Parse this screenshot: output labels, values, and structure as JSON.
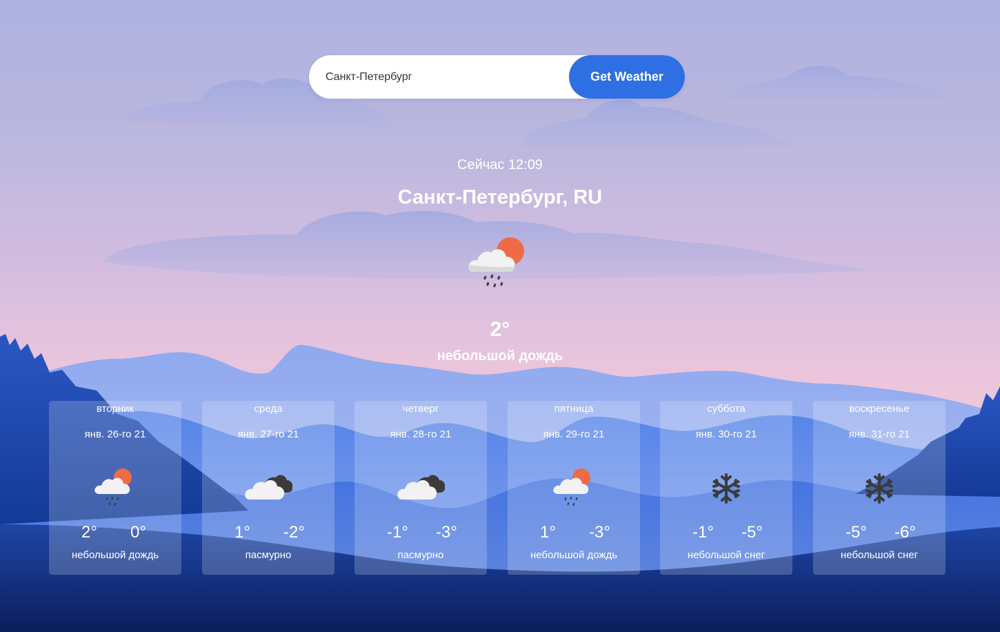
{
  "search": {
    "value": "Санкт-Петербург",
    "button_label": "Get Weather"
  },
  "current": {
    "time_label": "Сейчас 12:09",
    "location": "Санкт-Петербург, RU",
    "icon": "light-rain-sun-icon",
    "temperature": "2°",
    "description": "небольшой дождь"
  },
  "forecast": [
    {
      "day": "вторник",
      "date": "янв. 26-го 21",
      "icon": "light-rain-sun-icon",
      "max": "2°",
      "min": "0°",
      "description": "небольшой дождь"
    },
    {
      "day": "среда",
      "date": "янв. 27-го 21",
      "icon": "overcast-icon",
      "max": "1°",
      "min": "-2°",
      "description": "пасмурно"
    },
    {
      "day": "четверг",
      "date": "янв. 28-го 21",
      "icon": "overcast-icon",
      "max": "-1°",
      "min": "-3°",
      "description": "пасмурно"
    },
    {
      "day": "пятница",
      "date": "янв. 29-го 21",
      "icon": "light-rain-sun-icon",
      "max": "1°",
      "min": "-3°",
      "description": "небольшой дождь"
    },
    {
      "day": "суббота",
      "date": "янв. 30-го 21",
      "icon": "snowflake-icon",
      "max": "-1°",
      "min": "-5°",
      "description": "небольшой снег"
    },
    {
      "day": "воскресенье",
      "date": "янв. 31-го 21",
      "icon": "snowflake-icon",
      "max": "-5°",
      "min": "-6°",
      "description": "небольшой снег"
    }
  ],
  "colors": {
    "accent": "#2f6fe4",
    "sun": "#ef6a45",
    "cloud": "#f2f2f2",
    "dark_cloud": "#3b3b3b"
  }
}
